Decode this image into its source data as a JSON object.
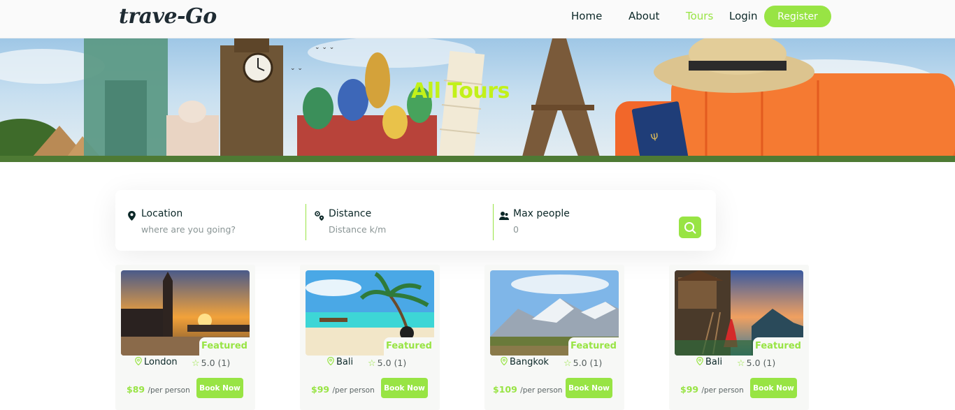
{
  "brand": {
    "logo_text": "trave-Go",
    "accent_color": "#98e444"
  },
  "nav": {
    "home": "Home",
    "about": "About",
    "tours": "Tours",
    "login": "Login",
    "register": "Register"
  },
  "hero": {
    "title": "All Tours"
  },
  "search": {
    "location": {
      "label": "Location",
      "placeholder": "where are you going?",
      "icon": "location-pin-icon"
    },
    "distance": {
      "label": "Distance",
      "placeholder": "Distance k/m",
      "icon": "route-icon"
    },
    "max_people": {
      "label": "Max people",
      "placeholder": "0",
      "icon": "people-icon"
    },
    "button_icon": "search-icon"
  },
  "tours": [
    {
      "city": "London",
      "featured": "Featured",
      "rating": "5.0",
      "reviews": "(1)",
      "price": "$89",
      "per": "/per person",
      "book": "Book Now"
    },
    {
      "city": "Bali",
      "featured": "Featured",
      "rating": "5.0",
      "reviews": "(1)",
      "price": "$99",
      "per": "/per person",
      "book": "Book Now"
    },
    {
      "city": "Bangkok",
      "featured": "Featured",
      "rating": "5.0",
      "reviews": "(1)",
      "price": "$109",
      "per": "/per person",
      "book": "Book Now"
    },
    {
      "city": "Bali",
      "featured": "Featured",
      "rating": "5.0",
      "reviews": "(1)",
      "price": "$99",
      "per": "/per person",
      "book": "Book Now"
    }
  ]
}
